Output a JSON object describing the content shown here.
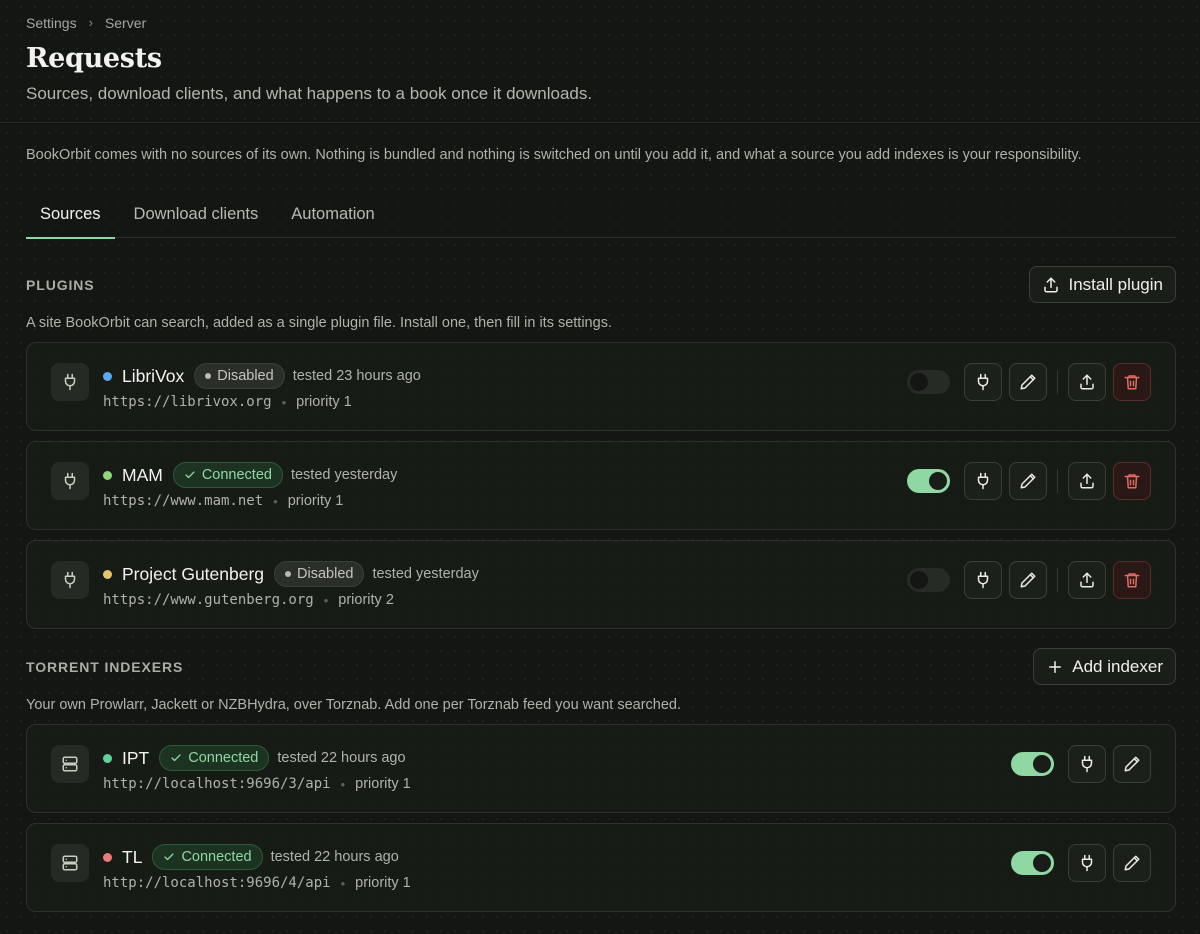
{
  "breadcrumb": {
    "root": "Settings",
    "current": "Server"
  },
  "page": {
    "title": "Requests",
    "subtitle": "Sources, download clients, and what happens to a book once it downloads."
  },
  "notice": "BookOrbit comes with no sources of its own. Nothing is bundled and nothing is switched on until you add it, and what a source you add indexes is your responsibility.",
  "tabs": [
    {
      "label": "Sources",
      "active": true
    },
    {
      "label": "Download clients",
      "active": false
    },
    {
      "label": "Automation",
      "active": false
    }
  ],
  "plugins": {
    "title": "PLUGINS",
    "button_label": "Install plugin",
    "description": "A site BookOrbit can search, added as a single plugin file. Install one, then fill in its settings.",
    "items": [
      {
        "name": "LibriVox",
        "dot_color": "#5aa9f2",
        "status": "Disabled",
        "enabled": false,
        "tested": "tested 23 hours ago",
        "url": "https://librivox.org",
        "priority": "priority 1"
      },
      {
        "name": "MAM",
        "dot_color": "#8fd67a",
        "status": "Connected",
        "enabled": true,
        "tested": "tested yesterday",
        "url": "https://www.mam.net",
        "priority": "priority 1"
      },
      {
        "name": "Project Gutenberg",
        "dot_color": "#e6c46a",
        "status": "Disabled",
        "enabled": false,
        "tested": "tested yesterday",
        "url": "https://www.gutenberg.org",
        "priority": "priority 2"
      }
    ]
  },
  "indexers": {
    "title": "TORRENT INDEXERS",
    "button_label": "Add indexer",
    "description": "Your own Prowlarr, Jackett or NZBHydra, over Torznab. Add one per Torznab feed you want searched.",
    "items": [
      {
        "name": "IPT",
        "dot_color": "#5fd39a",
        "status": "Connected",
        "enabled": true,
        "tested": "tested 22 hours ago",
        "url": "http://localhost:9696/3/api",
        "priority": "priority 1"
      },
      {
        "name": "TL",
        "dot_color": "#ef7a7a",
        "status": "Connected",
        "enabled": true,
        "tested": "tested 22 hours ago",
        "url": "http://localhost:9696/4/api",
        "priority": "priority 1"
      }
    ]
  },
  "icons": {
    "plugin_card": "plug-icon",
    "indexer_card": "server-icon",
    "test": "plug-icon",
    "edit": "pencil-icon",
    "export": "upload-icon",
    "delete": "trash-icon",
    "install": "upload-icon",
    "add": "plus-icon"
  },
  "colors": {
    "accent": "#8fd8a3",
    "danger": "#e36a62",
    "background": "#131612"
  }
}
